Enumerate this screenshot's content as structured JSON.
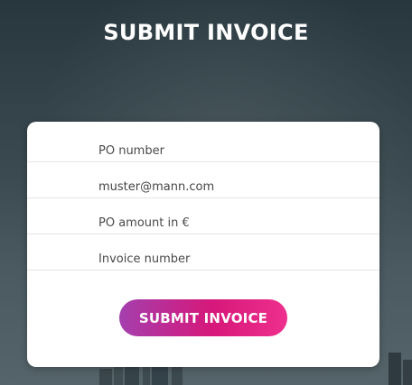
{
  "page": {
    "title": "SUBMIT INVOICE"
  },
  "form": {
    "fields": [
      {
        "placeholder": "PO number",
        "value": ""
      },
      {
        "placeholder": "",
        "value": "muster@mann.com"
      },
      {
        "placeholder": "PO amount in €",
        "value": ""
      },
      {
        "placeholder": "Invoice number",
        "value": ""
      }
    ],
    "submit_label": "SUBMIT INVOICE"
  },
  "colors": {
    "button_gradient_start": "#a43fae",
    "button_gradient_end": "#ee2f8d",
    "background": "#2f3f45",
    "card": "#ffffff"
  }
}
